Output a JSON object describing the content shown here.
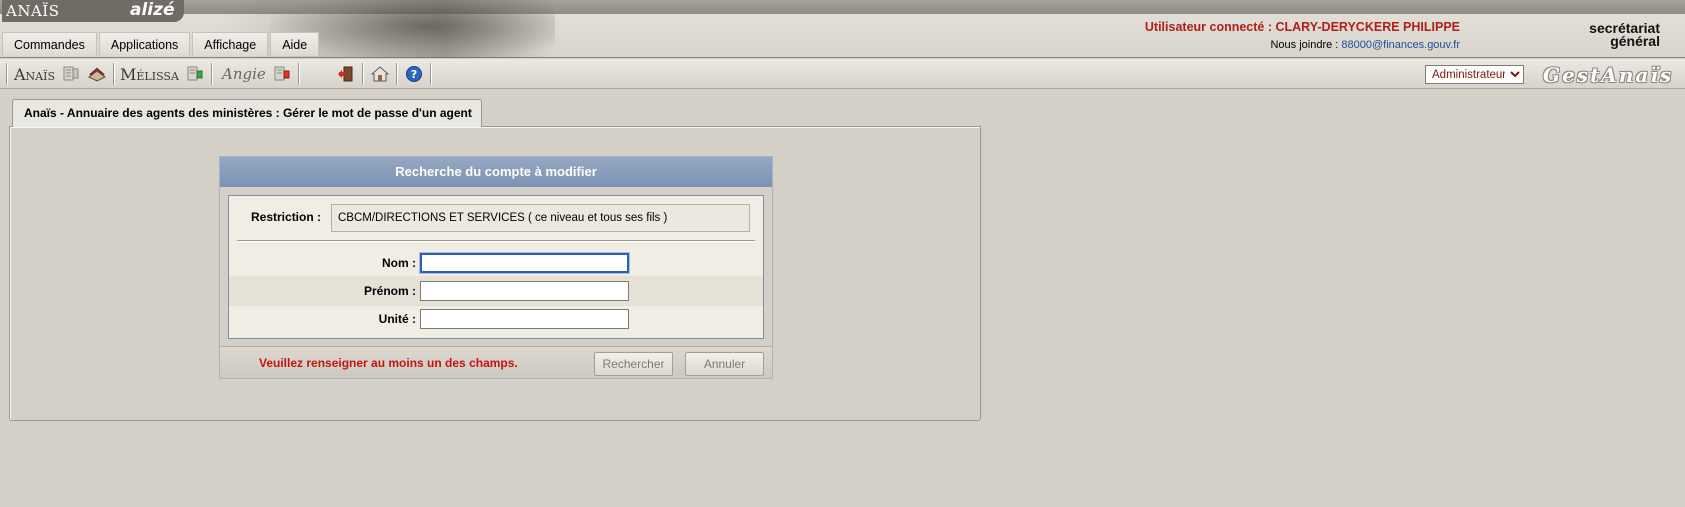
{
  "header": {
    "logo_anais": "ANAÏS",
    "logo_alize": "alizé",
    "user_connected_label": "Utilisateur connecté : CLARY-DERYCKERE PHILIPPE",
    "contact_prefix": "Nous joindre :",
    "contact_email": "88000@finances.gouv.fr",
    "org_line1": "secrétariat",
    "org_line2": "général"
  },
  "menu": {
    "items": [
      "Commandes",
      "Applications",
      "Affichage",
      "Aide"
    ]
  },
  "toolbar": {
    "anais_label": "Anaïs",
    "melissa_label": "Mélissa",
    "angie_label": "Angie",
    "role_selected": "Administrateur",
    "gest_logo": "GestAnaïs",
    "icons": [
      "directory-add-icon",
      "book-icon",
      "directory-add-icon",
      "directory-add-icon",
      "exit-door-icon",
      "home-icon",
      "help-icon"
    ]
  },
  "tab": {
    "title": "Anaïs - Annuaire des agents des ministères : Gérer le mot de passe d'un agent"
  },
  "dialog": {
    "title": "Recherche du compte à modifier",
    "restriction_label": "Restriction :",
    "restriction_value": "CBCM/DIRECTIONS ET SERVICES ( ce niveau et tous ses fils )",
    "fields": [
      {
        "label": "Nom  :",
        "value": ""
      },
      {
        "label": "Prénom  :",
        "value": ""
      },
      {
        "label": "Unité  :",
        "value": ""
      }
    ],
    "warning": "Veuillez renseigner au moins un des champs.",
    "search_button": "Rechercher",
    "cancel_button": "Annuler"
  },
  "colors": {
    "user_text": "#b0201a",
    "warning_text": "#c4140e",
    "dialog_header": "#8a9fbb",
    "link": "#1a4f99"
  }
}
